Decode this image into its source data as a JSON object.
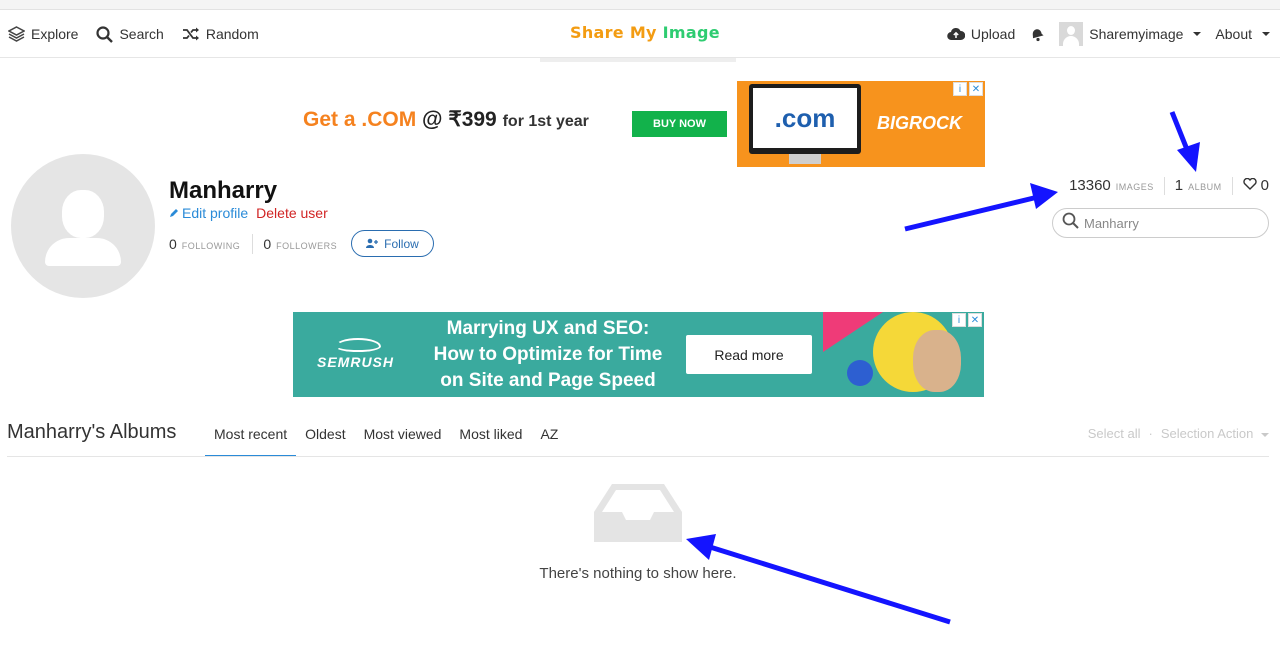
{
  "nav": {
    "explore": "Explore",
    "search": "Search",
    "random": "Random",
    "logo_part1": "Share My",
    "logo_part2": "Image",
    "upload": "Upload",
    "username": "Sharemyimage",
    "about": "About"
  },
  "ad_top": {
    "text_main": "Get a .COM",
    "text_at": "@ ₹399",
    "text_year": "for 1st year",
    "button": "BUY NOW",
    "screen_text": ".com",
    "brand": "BIGROCK"
  },
  "profile": {
    "name": "Manharry",
    "edit": "Edit profile",
    "delete": "Delete user",
    "following_count": "0",
    "following_label": "FOLLOWING",
    "followers_count": "0",
    "followers_label": "FOLLOWERS",
    "follow_button": "Follow",
    "images_count": "13360",
    "images_label": "IMAGES",
    "albums_count": "1",
    "albums_label": "ALBUM",
    "likes_count": "0",
    "search_placeholder": "Manharry"
  },
  "ad_bottom": {
    "brand": "SEMRUSH",
    "headline_line1": "Marrying UX and SEO:",
    "headline_line2": "How to Optimize for Time",
    "headline_line3": "on Site and Page Speed",
    "button": "Read more"
  },
  "albums": {
    "title": "Manharry's Albums",
    "tabs": [
      "Most recent",
      "Oldest",
      "Most viewed",
      "Most liked",
      "AZ"
    ],
    "select_all": "Select all",
    "selection_action": "Selection Action",
    "empty_message": "There's nothing to show here."
  },
  "colors": {
    "accent": "#2a8bd8",
    "delete": "#d12424",
    "arrow": "#1414ff"
  }
}
